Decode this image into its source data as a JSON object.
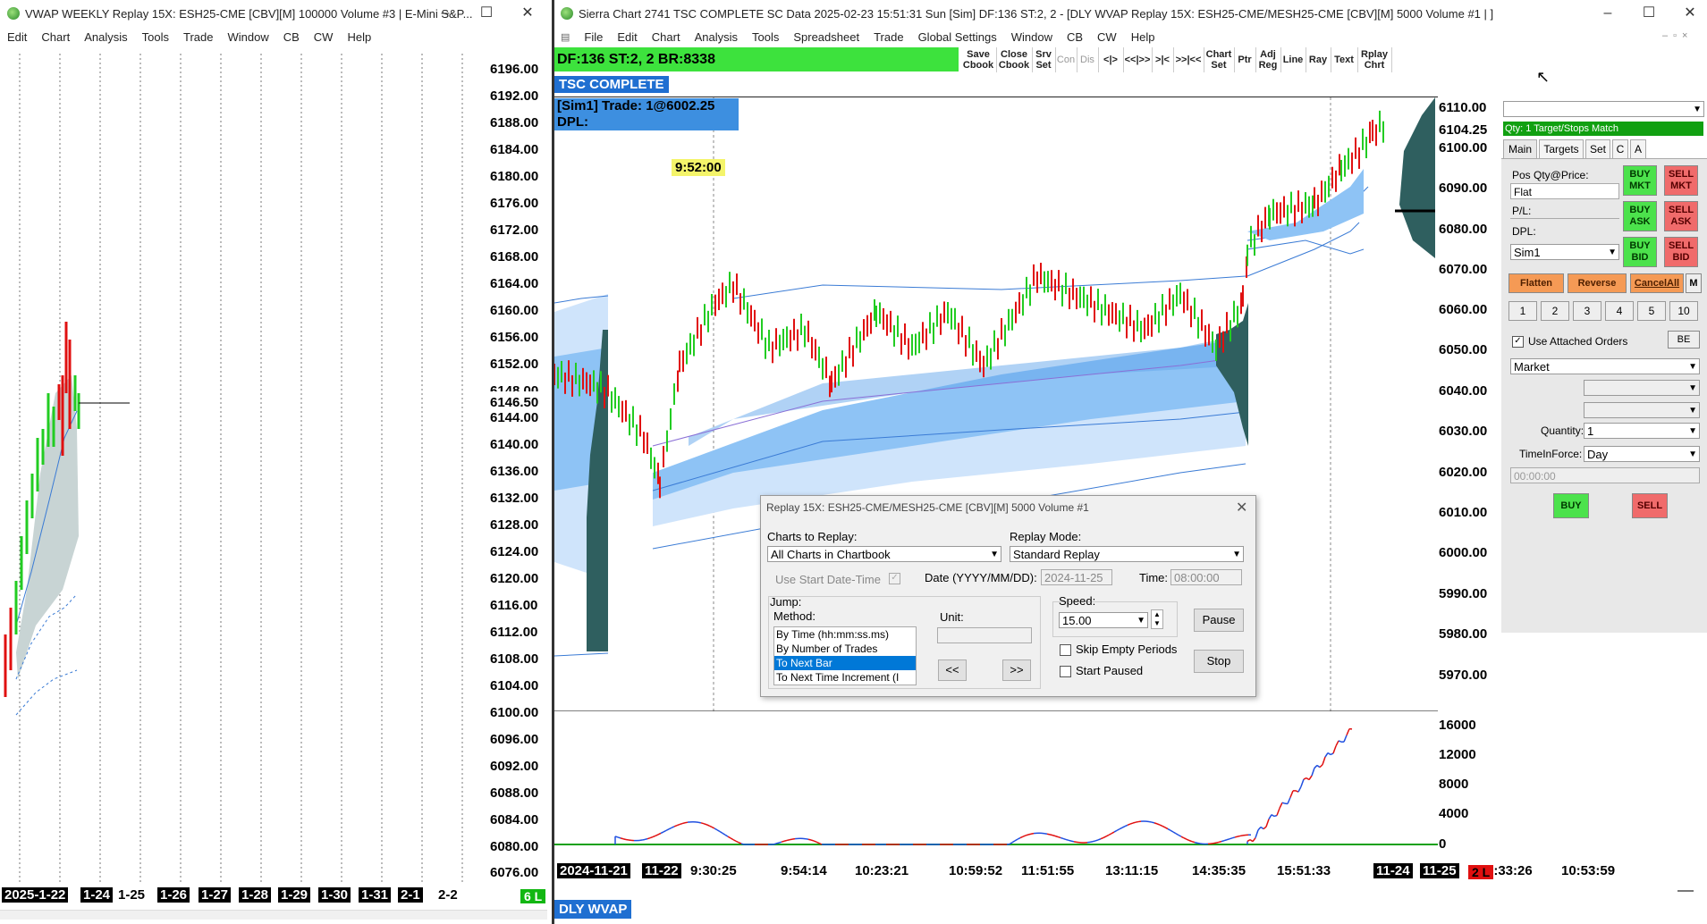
{
  "left_window": {
    "title": "VWAP WEEKLY Replay 15X: ESH25-CME [CBV][M]  100000 Volume #3 | E-Mini S&P...",
    "menu": [
      "Edit",
      "Chart",
      "Analysis",
      "Tools",
      "Trade",
      "Window",
      "CB",
      "CW",
      "Help"
    ],
    "price_labels": [
      "6196.00",
      "6192.00",
      "6188.00",
      "6184.00",
      "6180.00",
      "6176.00",
      "6172.00",
      "6168.00",
      "6164.00",
      "6160.00",
      "6156.00",
      "6152.00",
      "6148.00",
      "6146.50",
      "6144.00",
      "6140.00",
      "6136.00",
      "6132.00",
      "6128.00",
      "6124.00",
      "6120.00",
      "6116.00",
      "6112.00",
      "6108.00",
      "6104.00",
      "6100.00",
      "6096.00",
      "6092.00",
      "6088.00",
      "6084.00",
      "6080.00",
      "6076.00"
    ],
    "date_labels": [
      "2025-1-22",
      "1-24",
      "1-25",
      "1-26",
      "1-27",
      "1-28",
      "1-29",
      "1-30",
      "1-31",
      "2-1",
      "2-2"
    ],
    "corner_badge": "6 L"
  },
  "main_window": {
    "title": "Sierra Chart 2741 TSC COMPLETE SC Data 2025-02-23  15:51:31 Sun [Sim] DF:136  ST:2, 2 - [DLY WVAP Replay 15X: ESH25-CME/MESH25-CME [CBV][M]  5000 Volume #1 | ]",
    "menu": [
      "File",
      "Edit",
      "Chart",
      "Analysis",
      "Tools",
      "Spreadsheet",
      "Trade",
      "Global Settings",
      "Window",
      "CB",
      "CW",
      "Help"
    ],
    "status_bar": "DF:136  ST:2, 2  BR:8338",
    "toolbar": [
      {
        "label": "Save\nCbook"
      },
      {
        "label": "Close\nCbook"
      },
      {
        "label": "Srv\nSet"
      },
      {
        "label": "Con"
      },
      {
        "label": "Dis"
      },
      {
        "label": "<|>"
      },
      {
        "label": "<<|>>"
      },
      {
        "label": ">|<"
      },
      {
        "label": ">>|<<"
      },
      {
        "label": "Chart\nSet"
      },
      {
        "label": "Ptr"
      },
      {
        "label": "Adj\nReg"
      },
      {
        "label": "Line"
      },
      {
        "label": "Ray"
      },
      {
        "label": "Text"
      },
      {
        "label": "Rplay\nChrt"
      }
    ],
    "chart_name": "TSC COMPLETE",
    "trade_info": "[Sim1]  Trade: 1@6002.25",
    "dpl_label": "DPL:",
    "time_marker": "9:52:00",
    "price_labels": [
      "6110.00",
      "6104.25",
      "6100.00",
      "6090.00",
      "6080.00",
      "6070.00",
      "6060.00",
      "6050.00",
      "6040.00",
      "6030.00",
      "6020.00",
      "6010.00",
      "6000.00",
      "5990.00",
      "5980.00",
      "5970.00"
    ],
    "volume_labels": [
      "16000",
      "12000",
      "8000",
      "4000",
      "0"
    ],
    "time_labels": [
      "2024-11-21",
      "11-22",
      "9:30:25",
      "9:54:14",
      "10:23:21",
      "10:59:52",
      "11:51:55",
      "13:11:15",
      "14:35:35",
      "15:51:33",
      "11-24",
      "11-25",
      "9:33:26",
      "10:53:59"
    ],
    "corner_badge": "2 L",
    "study_label": "DLY WVAP"
  },
  "replay_dialog": {
    "title": "Replay 15X: ESH25-CME/MESH25-CME [CBV][M]  5000 Volume #1",
    "charts_to_replay_label": "Charts to Replay:",
    "charts_to_replay_value": "All Charts in Chartbook",
    "replay_mode_label": "Replay Mode:",
    "replay_mode_value": "Standard Replay",
    "use_start_label": "Use Start Date-Time",
    "date_label": "Date (YYYY/MM/DD):",
    "date_value": "2024-11-25",
    "time_label": "Time:",
    "time_value": "08:00:00",
    "jump_label": "Jump:",
    "method_label": "Method:",
    "methods": [
      "By Time (hh:mm:ss.ms)",
      "By Number of Trades",
      "To Next Bar",
      "To Next Time Increment (I"
    ],
    "selected_method_index": 2,
    "unit_label": "Unit:",
    "back_button": "<<",
    "forward_button": ">>",
    "speed_label": "Speed:",
    "speed_value": "15.00",
    "pause_button": "Pause",
    "stop_button": "Stop",
    "skip_empty_label": "Skip Empty Periods",
    "start_paused_label": "Start Paused"
  },
  "trade_panel": {
    "banner": "Qty: 1 Target/Stops Match",
    "tabs": [
      "Main",
      "Targets",
      "Set",
      "C",
      "A"
    ],
    "pos_label": "Pos Qty@Price:",
    "pos_value": "Flat",
    "pl_label": "P/L:",
    "dpl_label": "DPL:",
    "account": "Sim1",
    "buy_mkt": "BUY\nMKT",
    "sell_mkt": "SELL\nMKT",
    "buy_ask": "BUY\nASK",
    "sell_ask": "SELL\nASK",
    "buy_bid": "BUY\nBID",
    "sell_bid": "SELL\nBID",
    "flatten": "Flatten",
    "reverse": "Reverse",
    "cancel_all": "CancelAll",
    "m_label": "M",
    "qty_buttons": [
      "1",
      "2",
      "3",
      "4",
      "5",
      "10"
    ],
    "use_attached_label": "Use Attached Orders",
    "be_label": "BE",
    "order_type": "Market",
    "quantity_label": "Quantity:",
    "quantity_value": "1",
    "tif_label": "TimeInForce:",
    "tif_value": "Day",
    "time_placeholder": "00:00:00",
    "buy_button": "BUY",
    "sell_button": "SELL"
  },
  "colors": {
    "status_green": "#3de23d",
    "chart_name_bg": "#1f6fd1",
    "vwap_band_dark": "#8ec3f5",
    "vwap_band_light": "#cfe4fb",
    "up_bar": "#22cc22",
    "down_bar": "#e01010",
    "volume_profile": "#2f5f5f"
  }
}
